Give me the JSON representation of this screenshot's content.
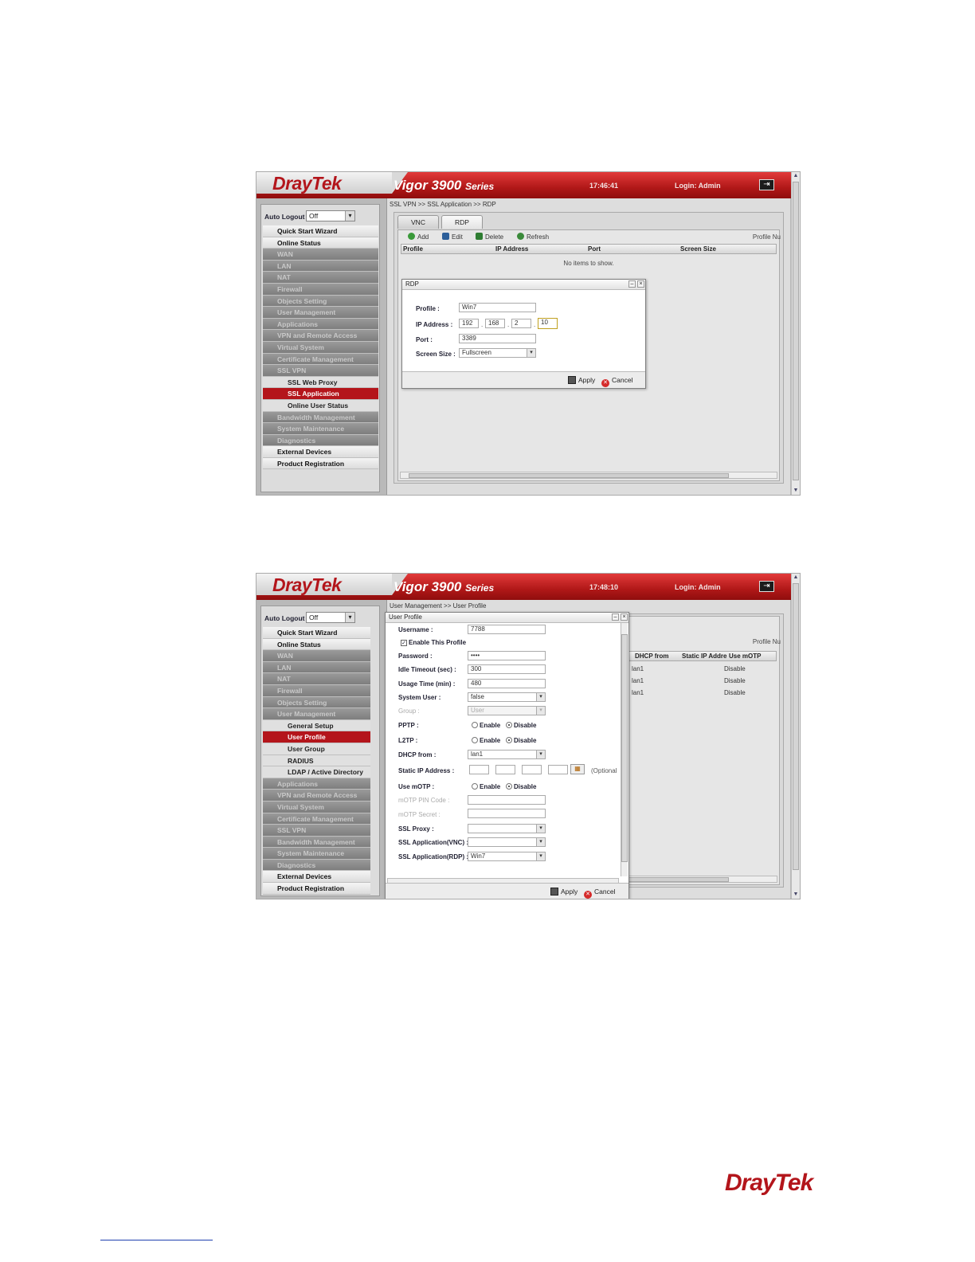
{
  "shot1": {
    "brand": "DrayTek",
    "series_main": "Vigor 3900",
    "series_suffix": "Series",
    "time": "17:46:41",
    "login": "Login: Admin",
    "auto_logout_label": "Auto Logout :",
    "auto_logout_value": "Off",
    "menu": [
      {
        "label": "Quick Start Wizard",
        "state": "on"
      },
      {
        "label": "Online Status",
        "state": "on"
      },
      {
        "label": "WAN",
        "state": "off"
      },
      {
        "label": "LAN",
        "state": "off"
      },
      {
        "label": "NAT",
        "state": "off"
      },
      {
        "label": "Firewall",
        "state": "off"
      },
      {
        "label": "Objects Setting",
        "state": "off"
      },
      {
        "label": "User Management",
        "state": "off"
      },
      {
        "label": "Applications",
        "state": "off"
      },
      {
        "label": "VPN and Remote Access",
        "state": "off"
      },
      {
        "label": "Virtual System",
        "state": "off"
      },
      {
        "label": "Certificate Management",
        "state": "off"
      },
      {
        "label": "SSL VPN",
        "state": "off"
      },
      {
        "label": "SSL Web Proxy",
        "state": "sub"
      },
      {
        "label": "SSL Application",
        "state": "act"
      },
      {
        "label": "Online User Status",
        "state": "sub"
      },
      {
        "label": "Bandwidth Management",
        "state": "off"
      },
      {
        "label": "System Maintenance",
        "state": "off"
      },
      {
        "label": "Diagnostics",
        "state": "off"
      },
      {
        "label": "External Devices",
        "state": "on"
      },
      {
        "label": "Product Registration",
        "state": "on"
      }
    ],
    "breadcrumb": "SSL VPN >> SSL Application >> RDP",
    "tabs": [
      "VNC",
      "RDP"
    ],
    "toolbar": {
      "add": "Add",
      "edit": "Edit",
      "delete": "Delete",
      "refresh": "Refresh",
      "profile_nu": "Profile Nu"
    },
    "columns": [
      "Profile",
      "IP Address",
      "Port",
      "Screen Size"
    ],
    "empty_text": "No items to show.",
    "dialog": {
      "title": "RDP",
      "profile_label": "Profile :",
      "profile_value": "Win7",
      "ip_label": "IP Address :",
      "ip": [
        "192",
        "168",
        "2",
        "10"
      ],
      "port_label": "Port :",
      "port_value": "3389",
      "screen_label": "Screen Size :",
      "screen_value": "Fullscreen",
      "apply": "Apply",
      "cancel": "Cancel"
    }
  },
  "shot2": {
    "brand": "DrayTek",
    "series_main": "Vigor 3900",
    "series_suffix": "Series",
    "time": "17:48:10",
    "login": "Login: Admin",
    "auto_logout_label": "Auto Logout :",
    "auto_logout_value": "Off",
    "menu": [
      {
        "label": "Quick Start Wizard",
        "state": "on"
      },
      {
        "label": "Online Status",
        "state": "on"
      },
      {
        "label": "WAN",
        "state": "off"
      },
      {
        "label": "LAN",
        "state": "off"
      },
      {
        "label": "NAT",
        "state": "off"
      },
      {
        "label": "Firewall",
        "state": "off"
      },
      {
        "label": "Objects Setting",
        "state": "off"
      },
      {
        "label": "User Management",
        "state": "off"
      },
      {
        "label": "General Setup",
        "state": "sub"
      },
      {
        "label": "User Profile",
        "state": "act"
      },
      {
        "label": "User Group",
        "state": "sub"
      },
      {
        "label": "RADIUS",
        "state": "sub"
      },
      {
        "label": "LDAP / Active Directory",
        "state": "sub"
      },
      {
        "label": "Applications",
        "state": "off"
      },
      {
        "label": "VPN and Remote Access",
        "state": "off"
      },
      {
        "label": "Virtual System",
        "state": "off"
      },
      {
        "label": "Certificate Management",
        "state": "off"
      },
      {
        "label": "SSL VPN",
        "state": "off"
      },
      {
        "label": "Bandwidth Management",
        "state": "off"
      },
      {
        "label": "System Maintenance",
        "state": "off"
      },
      {
        "label": "Diagnostics",
        "state": "off"
      },
      {
        "label": "External Devices",
        "state": "on"
      },
      {
        "label": "Product Registration",
        "state": "on"
      }
    ],
    "breadcrumb": "User Management >> User Profile",
    "profile_nu": "Profile Nu",
    "bg_columns": [
      "DHCP from",
      "Static IP Addre",
      "Use mOTP"
    ],
    "bg_rows": [
      {
        "dhcp": "lan1",
        "motp": "Disable"
      },
      {
        "dhcp": "lan1",
        "motp": "Disable"
      },
      {
        "dhcp": "lan1",
        "motp": "Disable"
      }
    ],
    "dialog": {
      "title": "User Profile",
      "username_label": "Username :",
      "username_value": "7788",
      "enable_label": "Enable This Profile",
      "password_label": "Password :",
      "password_value": "••••",
      "idle_label": "Idle Timeout (sec) :",
      "idle_value": "300",
      "usage_label": "Usage Time (min) :",
      "usage_value": "480",
      "sysuser_label": "System User :",
      "sysuser_value": "false",
      "group_label": "Group :",
      "group_value": "User",
      "pptp_label": "PPTP :",
      "l2tp_label": "L2TP :",
      "enable_opt": "Enable",
      "disable_opt": "Disable",
      "dhcp_label": "DHCP from :",
      "dhcp_value": "lan1",
      "static_ip_label": "Static IP Address :",
      "optional": "(Optional",
      "motp_label": "Use mOTP :",
      "motp_pin_label": "mOTP PIN Code :",
      "motp_secret_label": "mOTP Secret :",
      "ssl_proxy_label": "SSL Proxy :",
      "ssl_vnc_label": "SSL Application(VNC) :",
      "ssl_rdp_label": "SSL Application(RDP) :",
      "ssl_rdp_value": "Win7",
      "apply": "Apply",
      "cancel": "Cancel"
    }
  },
  "footer": {
    "brand": "DrayTek"
  }
}
